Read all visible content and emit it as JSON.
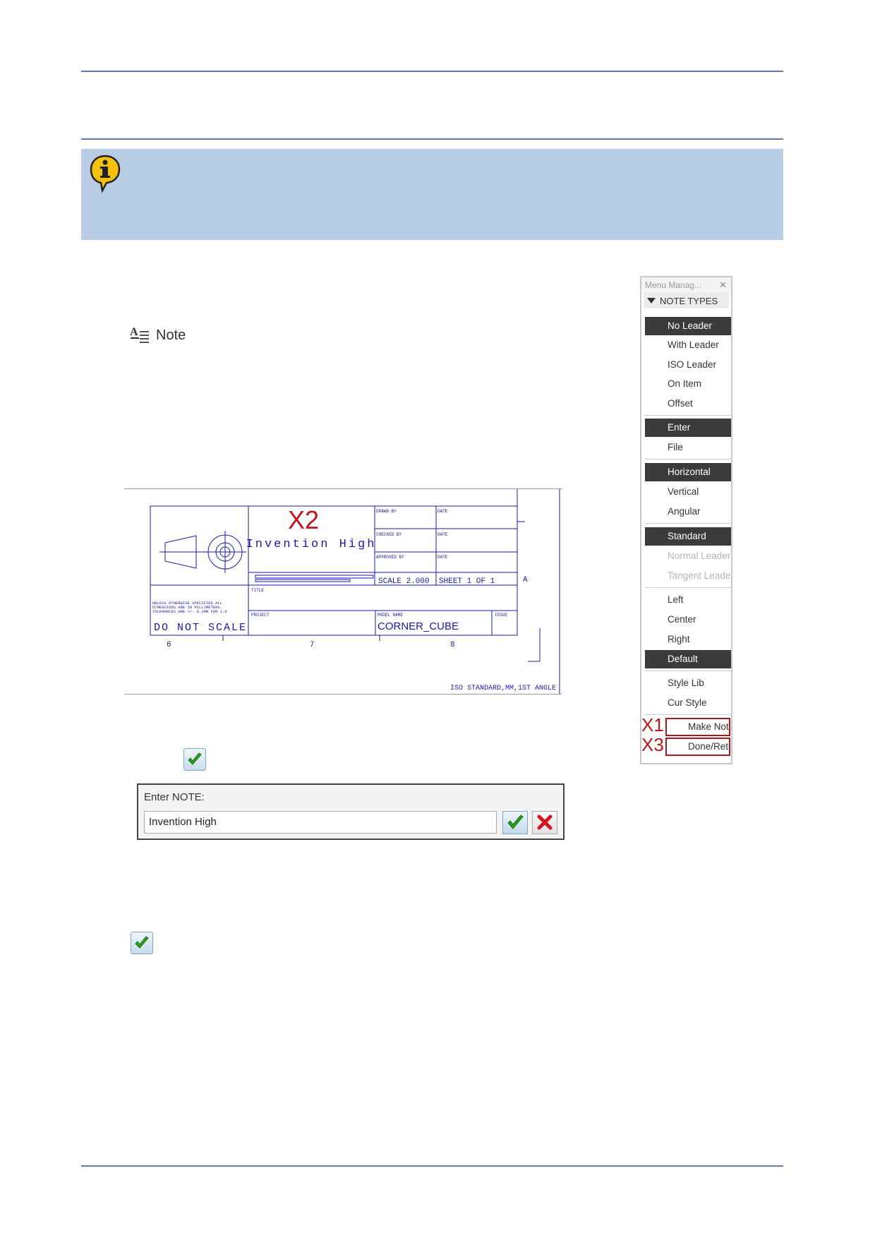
{
  "note_command": {
    "label": "Note",
    "icon": "note-icon"
  },
  "drawing": {
    "note_text": "Invention High",
    "marker": "X2",
    "do_not_scale": "DO NOT SCALE",
    "model_name": "CORNER_CUBE",
    "scale": "SCALE 2.000",
    "sheet": "SHEET  1 OF 1",
    "iso": "ISO STANDARD,MM,1ST ANGLE",
    "zone_a": "A",
    "col6": "6",
    "col7": "7",
    "col8": "8",
    "drawn_by": "DRAWN BY",
    "checked_by": "CHECKED BY",
    "approved_by": "APPROVED BY",
    "date": "DATE",
    "title": "TITLE",
    "project": "PROJECT",
    "model_name_label": "MODEL NAME",
    "issue": "ISSUE",
    "notes_line1": "UNLESS OTHERWISE SPECIFIED ALL",
    "notes_line2": "DIMENSIONS ARE IN MILLIMETERS.",
    "notes_line3": "TOLERANCES ARE +/- 0.1MM FOR 1.0"
  },
  "menu": {
    "title": "Menu Manag...",
    "close": "✕",
    "section": "NOTE TYPES",
    "items": {
      "no_leader": "No Leader",
      "with_leader": "With Leader",
      "iso_leader": "ISO Leader",
      "on_item": "On Item",
      "offset": "Offset",
      "enter": "Enter",
      "file": "File",
      "horizontal": "Horizontal",
      "vertical": "Vertical",
      "angular": "Angular",
      "standard": "Standard",
      "normal_leader": "Normal Leader",
      "tangent_leader": "Tangent Leader",
      "left": "Left",
      "center": "Center",
      "right": "Right",
      "default": "Default",
      "style_lib": "Style Lib",
      "cur_style": "Cur Style",
      "make_note": "Make Note",
      "done_return": "Done/Return"
    },
    "marker_x1": "X1",
    "marker_x3": "X3"
  },
  "enter_note": {
    "label": "Enter NOTE:",
    "value": "Invention High"
  },
  "colors": {
    "rule": "#5b7fb5",
    "info_bg": "#b8cce4",
    "marker": "#c1141b",
    "drawing_ink": "#1a1aa8"
  }
}
